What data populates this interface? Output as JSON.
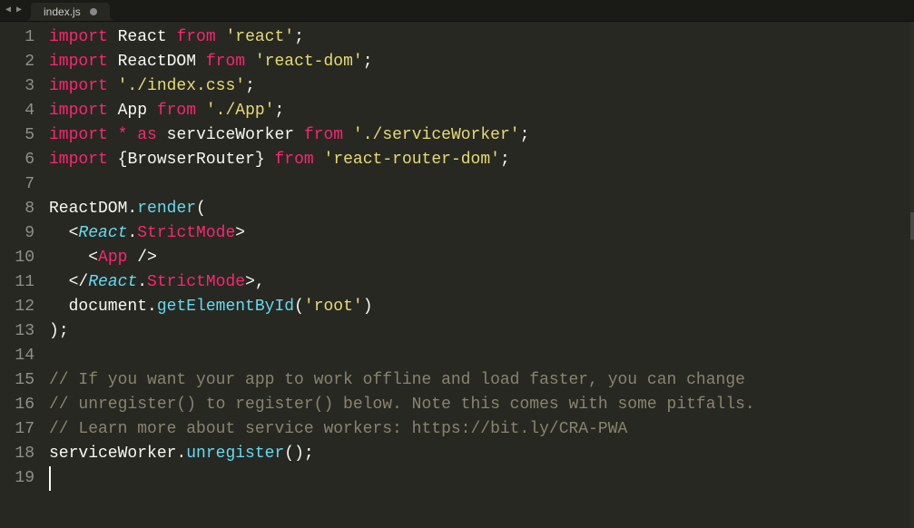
{
  "tab": {
    "filename": "index.js",
    "dirty": true
  },
  "lines": [
    {
      "n": "1",
      "tokens": [
        [
          "kw",
          "import"
        ],
        [
          "var",
          " React "
        ],
        [
          "kw",
          "from"
        ],
        [
          "var",
          " "
        ],
        [
          "str",
          "'react'"
        ],
        [
          "punc",
          ";"
        ]
      ]
    },
    {
      "n": "2",
      "tokens": [
        [
          "kw",
          "import"
        ],
        [
          "var",
          " ReactDOM "
        ],
        [
          "kw",
          "from"
        ],
        [
          "var",
          " "
        ],
        [
          "str",
          "'react-dom'"
        ],
        [
          "punc",
          ";"
        ]
      ]
    },
    {
      "n": "3",
      "tokens": [
        [
          "kw",
          "import"
        ],
        [
          "var",
          " "
        ],
        [
          "str",
          "'./index.css'"
        ],
        [
          "punc",
          ";"
        ]
      ]
    },
    {
      "n": "4",
      "tokens": [
        [
          "kw",
          "import"
        ],
        [
          "var",
          " App "
        ],
        [
          "kw",
          "from"
        ],
        [
          "var",
          " "
        ],
        [
          "str",
          "'./App'"
        ],
        [
          "punc",
          ";"
        ]
      ]
    },
    {
      "n": "5",
      "tokens": [
        [
          "kw",
          "import"
        ],
        [
          "var",
          " "
        ],
        [
          "op",
          "*"
        ],
        [
          "var",
          " "
        ],
        [
          "kw",
          "as"
        ],
        [
          "var",
          " serviceWorker "
        ],
        [
          "kw",
          "from"
        ],
        [
          "var",
          " "
        ],
        [
          "str",
          "'./serviceWorker'"
        ],
        [
          "punc",
          ";"
        ]
      ]
    },
    {
      "n": "6",
      "tokens": [
        [
          "kw",
          "import"
        ],
        [
          "var",
          " "
        ],
        [
          "punc",
          "{"
        ],
        [
          "var",
          "BrowserRouter"
        ],
        [
          "punc",
          "}"
        ],
        [
          "var",
          " "
        ],
        [
          "kw",
          "from"
        ],
        [
          "var",
          " "
        ],
        [
          "str",
          "'react-router-dom'"
        ],
        [
          "punc",
          ";"
        ]
      ]
    },
    {
      "n": "7",
      "tokens": []
    },
    {
      "n": "8",
      "tokens": [
        [
          "var",
          "ReactDOM"
        ],
        [
          "punc",
          "."
        ],
        [
          "func",
          "render"
        ],
        [
          "punc",
          "("
        ]
      ]
    },
    {
      "n": "9",
      "tokens": [
        [
          "var",
          "  "
        ],
        [
          "tag-bracket",
          "<"
        ],
        [
          "component",
          "React"
        ],
        [
          "punc",
          "."
        ],
        [
          "tag-name",
          "StrictMode"
        ],
        [
          "tag-bracket",
          ">"
        ]
      ]
    },
    {
      "n": "10",
      "tokens": [
        [
          "var",
          "    "
        ],
        [
          "tag-bracket",
          "<"
        ],
        [
          "tag-name",
          "App"
        ],
        [
          "var",
          " "
        ],
        [
          "tag-bracket",
          "/>"
        ]
      ]
    },
    {
      "n": "11",
      "tokens": [
        [
          "var",
          "  "
        ],
        [
          "tag-bracket",
          "</"
        ],
        [
          "component",
          "React"
        ],
        [
          "punc",
          "."
        ],
        [
          "tag-name",
          "StrictMode"
        ],
        [
          "tag-bracket",
          ">"
        ],
        [
          "punc",
          ","
        ]
      ]
    },
    {
      "n": "12",
      "tokens": [
        [
          "var",
          "  document"
        ],
        [
          "punc",
          "."
        ],
        [
          "func",
          "getElementById"
        ],
        [
          "punc",
          "("
        ],
        [
          "str",
          "'root'"
        ],
        [
          "punc",
          ")"
        ]
      ]
    },
    {
      "n": "13",
      "tokens": [
        [
          "punc",
          ")"
        ],
        [
          "punc",
          ";"
        ]
      ]
    },
    {
      "n": "14",
      "tokens": []
    },
    {
      "n": "15",
      "tokens": [
        [
          "comment",
          "// If you want your app to work offline and load faster, you can change"
        ]
      ]
    },
    {
      "n": "16",
      "tokens": [
        [
          "comment",
          "// unregister() to register() below. Note this comes with some pitfalls."
        ]
      ]
    },
    {
      "n": "17",
      "tokens": [
        [
          "comment",
          "// Learn more about service workers: https://bit.ly/CRA-PWA"
        ]
      ]
    },
    {
      "n": "18",
      "tokens": [
        [
          "var",
          "serviceWorker"
        ],
        [
          "punc",
          "."
        ],
        [
          "func",
          "unregister"
        ],
        [
          "punc",
          "()"
        ],
        [
          "punc",
          ";"
        ]
      ]
    },
    {
      "n": "19",
      "tokens": []
    }
  ]
}
